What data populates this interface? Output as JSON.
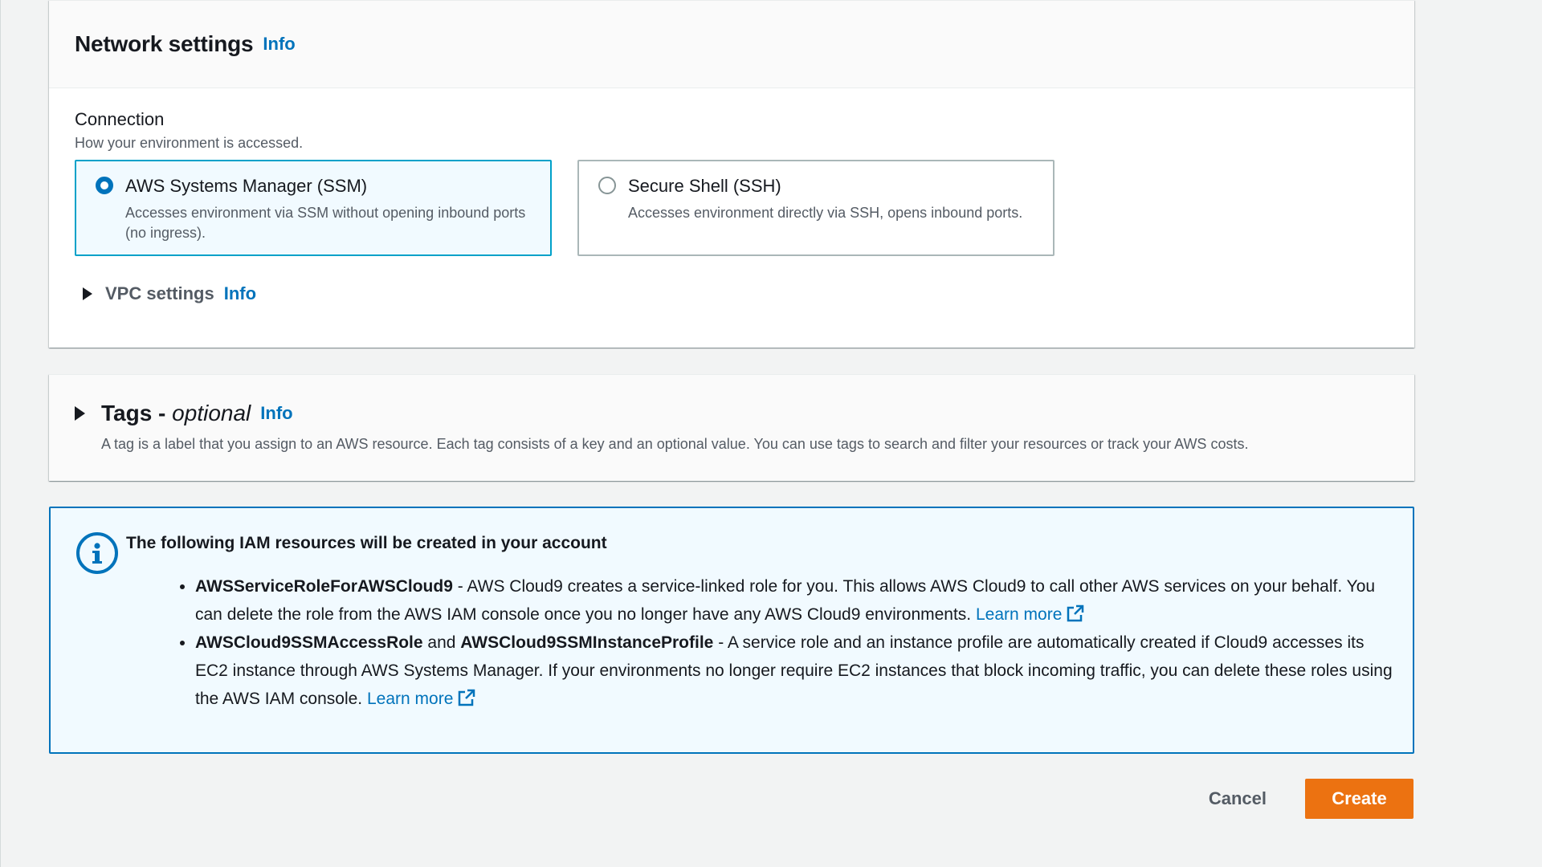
{
  "network": {
    "title": "Network settings",
    "info_label": "Info",
    "connection": {
      "label": "Connection",
      "description": "How your environment is accessed.",
      "options": [
        {
          "title": "AWS Systems Manager (SSM)",
          "description": "Accesses environment via SSM without opening inbound ports (no ingress).",
          "selected": true
        },
        {
          "title": "Secure Shell (SSH)",
          "description": "Accesses environment directly via SSH, opens inbound ports.",
          "selected": false
        }
      ]
    },
    "vpc": {
      "label": "VPC settings",
      "info_label": "Info"
    }
  },
  "tags": {
    "title_prefix": "Tags -",
    "title_optional": "optional",
    "info_label": "Info",
    "description": "A tag is a label that you assign to an AWS resource. Each tag consists of a key and an optional value. You can use tags to search and filter your resources or track your AWS costs."
  },
  "alert": {
    "title": "The following IAM resources will be created in your account",
    "items": [
      {
        "bold1": "AWSServiceRoleForAWSCloud9",
        "text": " - AWS Cloud9 creates a service-linked role for you. This allows AWS Cloud9 to call other AWS services on your behalf. You can delete the role from the AWS IAM console once you no longer have any AWS Cloud9 environments. ",
        "link": "Learn more"
      },
      {
        "bold1": "AWSCloud9SSMAccessRole",
        "joiner": " and ",
        "bold2": "AWSCloud9SSMInstanceProfile",
        "text": " - A service role and an instance profile are automatically created if Cloud9 accesses its EC2 instance through AWS Systems Manager. If your environments no longer require EC2 instances that block incoming traffic, you can delete these roles using the AWS IAM console. ",
        "link": "Learn more"
      }
    ]
  },
  "actions": {
    "cancel_label": "Cancel",
    "create_label": "Create"
  },
  "colors": {
    "accent": "#0073bb",
    "primary_button": "#ec7211",
    "selected_tile_border": "#00a1c9"
  }
}
